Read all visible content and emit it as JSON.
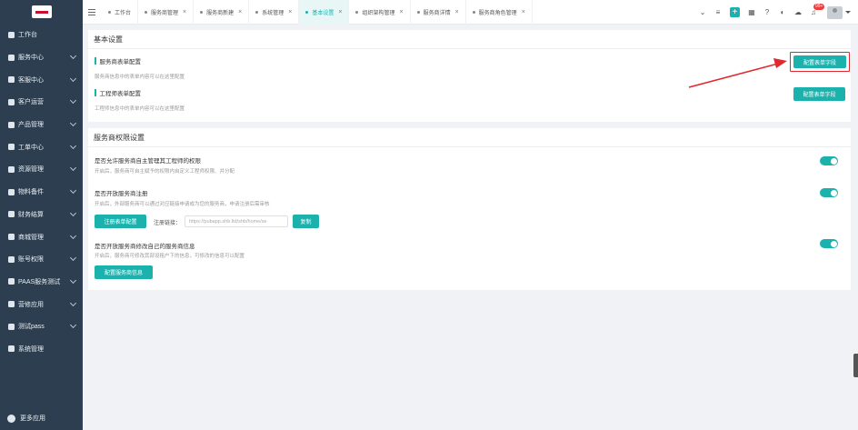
{
  "sidebar": {
    "items": [
      {
        "label": "工作台",
        "icon": "home-icon",
        "has_caret": false
      },
      {
        "label": "服务中心",
        "icon": "shield-icon",
        "has_caret": true
      },
      {
        "label": "客服中心",
        "icon": "car-icon",
        "has_caret": true
      },
      {
        "label": "客户运营",
        "icon": "document-icon",
        "has_caret": true
      },
      {
        "label": "产品管理",
        "icon": "folder-icon",
        "has_caret": true
      },
      {
        "label": "工单中心",
        "icon": "monitor-icon",
        "has_caret": true
      },
      {
        "label": "资源管理",
        "icon": "cart-icon",
        "has_caret": true
      },
      {
        "label": "物料备件",
        "icon": "box-icon",
        "has_caret": true
      },
      {
        "label": "财务结算",
        "icon": "calculator-icon",
        "has_caret": true
      },
      {
        "label": "商城管理",
        "icon": "store-icon",
        "has_caret": true
      },
      {
        "label": "账号权限",
        "icon": "location-icon",
        "has_caret": true
      },
      {
        "label": "PAAS服务测试",
        "icon": "apps-icon",
        "has_caret": true
      },
      {
        "label": "营修应用",
        "icon": "monitor-icon",
        "has_caret": true
      },
      {
        "label": "测试pass",
        "icon": "grid-icon",
        "has_caret": true
      },
      {
        "label": "系统管理",
        "icon": "gear-icon",
        "has_caret": false
      }
    ],
    "footer": "更多应用"
  },
  "tabs": [
    {
      "label": "工作台",
      "closable": false,
      "active": false
    },
    {
      "label": "服务商管理",
      "closable": true,
      "active": false
    },
    {
      "label": "服务商新建",
      "closable": true,
      "active": false
    },
    {
      "label": "系统管理",
      "closable": true,
      "active": false
    },
    {
      "label": "基本设置",
      "closable": true,
      "active": true
    },
    {
      "label": "组织架构管理",
      "closable": true,
      "active": false
    },
    {
      "label": "服务商详情",
      "closable": true,
      "active": false
    },
    {
      "label": "服务商角色管理",
      "closable": true,
      "active": false
    }
  ],
  "topbar": {
    "notification_count": "99+"
  },
  "basic_settings": {
    "title": "基本设置",
    "rows": [
      {
        "title": "服务商表单配置",
        "desc": "服务商信息中的表单内容可以在这里配置",
        "button": "配置表单字段"
      },
      {
        "title": "工程师表单配置",
        "desc": "工程师信息中的表单内容可以在这里配置",
        "button": "配置表单字段"
      }
    ]
  },
  "permission_settings": {
    "title": "服务商权限设置",
    "options": [
      {
        "title": "是否允许服务商自主管理其工程师的权限",
        "desc": "开启后，服务商可自主赋予的权限内自定义工程师权限、并分配",
        "enabled": true
      },
      {
        "title": "是否开放服务商注册",
        "desc": "开启后，外部服务商可以通过对应链接申请成为您的服务商，申请注册后需审核",
        "enabled": true,
        "button": "注册表单配置",
        "link_label": "注册链接：",
        "link_value": "https://pubapp.shb.ltd/shb/home/se",
        "copy_button": "复制"
      },
      {
        "title": "是否开放服务商修改自己的服务商信息",
        "desc": "开启后，服务商可修改其部设租户下的信息，可修改的信息可以配置",
        "enabled": true,
        "button": "配置服务商信息"
      }
    ]
  },
  "colors": {
    "accent": "#1bb2ad",
    "sidebar": "#2c3e50",
    "highlight": "#e0282e"
  }
}
